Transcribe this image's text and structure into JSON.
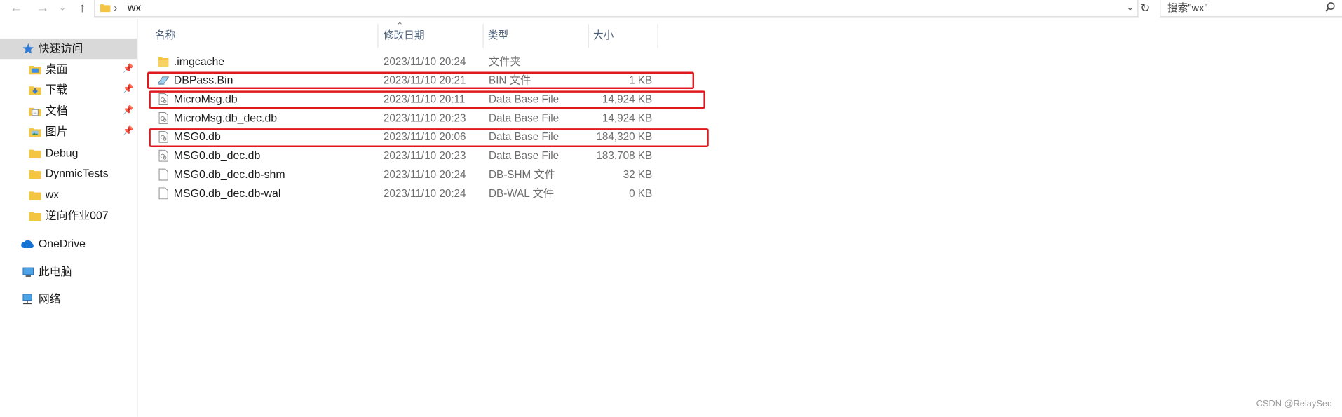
{
  "address": {
    "crumb": "wx"
  },
  "search": {
    "placeholder": "搜索\"wx\""
  },
  "sidebar": {
    "items": [
      {
        "label": "快速访问",
        "icon": "star-icon"
      },
      {
        "label": "桌面",
        "icon": "desktop-folder-icon",
        "pinned": true
      },
      {
        "label": "下载",
        "icon": "download-folder-icon",
        "pinned": true
      },
      {
        "label": "文档",
        "icon": "documents-folder-icon",
        "pinned": true
      },
      {
        "label": "图片",
        "icon": "pictures-folder-icon",
        "pinned": true
      },
      {
        "label": "Debug",
        "icon": "folder-icon"
      },
      {
        "label": "DynmicTests",
        "icon": "folder-icon"
      },
      {
        "label": "wx",
        "icon": "folder-icon"
      },
      {
        "label": "逆向作业007",
        "icon": "folder-icon"
      },
      {
        "label": "OneDrive",
        "icon": "cloud-icon"
      },
      {
        "label": "此电脑",
        "icon": "computer-icon"
      },
      {
        "label": "网络",
        "icon": "network-icon"
      }
    ]
  },
  "columns": {
    "name": "名称",
    "date": "修改日期",
    "type": "类型",
    "size": "大小"
  },
  "files": [
    {
      "name": ".imgcache",
      "date": "2023/11/10 20:24",
      "type": "文件夹",
      "size": "",
      "icon": "folder-icon"
    },
    {
      "name": "DBPass.Bin",
      "date": "2023/11/10 20:21",
      "type": "BIN 文件",
      "size": "1 KB",
      "icon": "bin-file-icon"
    },
    {
      "name": "MicroMsg.db",
      "date": "2023/11/10 20:11",
      "type": "Data Base File",
      "size": "14,924 KB",
      "icon": "db-file-icon"
    },
    {
      "name": "MicroMsg.db_dec.db",
      "date": "2023/11/10 20:23",
      "type": "Data Base File",
      "size": "14,924 KB",
      "icon": "db-file-icon"
    },
    {
      "name": "MSG0.db",
      "date": "2023/11/10 20:06",
      "type": "Data Base File",
      "size": "184,320 KB",
      "icon": "db-file-icon"
    },
    {
      "name": "MSG0.db_dec.db",
      "date": "2023/11/10 20:23",
      "type": "Data Base File",
      "size": "183,708 KB",
      "icon": "db-file-icon"
    },
    {
      "name": "MSG0.db_dec.db-shm",
      "date": "2023/11/10 20:24",
      "type": "DB-SHM 文件",
      "size": "32 KB",
      "icon": "blank-file-icon"
    },
    {
      "name": "MSG0.db_dec.db-wal",
      "date": "2023/11/10 20:24",
      "type": "DB-WAL 文件",
      "size": "0 KB",
      "icon": "blank-file-icon"
    }
  ],
  "highlighted_files": [
    "DBPass.Bin",
    "MicroMsg.db",
    "MSG0.db"
  ],
  "colors": {
    "highlight": "#e0191f",
    "selected_bg": "#d9d9d9",
    "folder": "#f4c542",
    "header_text": "#4c607a"
  },
  "watermark": "CSDN @RelaySec"
}
